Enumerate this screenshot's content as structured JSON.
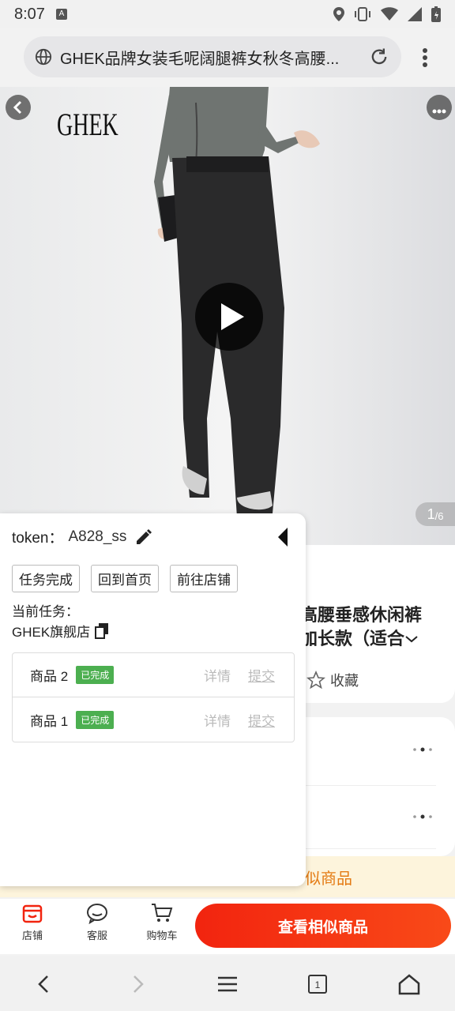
{
  "status_bar": {
    "time": "8:07",
    "a_badge": "A"
  },
  "browser": {
    "url_title": "GHEK品牌女装毛呢阔腿裤女秋冬高腰..."
  },
  "hero": {
    "brand": "GHEK",
    "pager_current": "1",
    "pager_total": "/6"
  },
  "product": {
    "title_line1": "高腰垂感休闲裤",
    "title_line2": "加长款（适合",
    "favorite_label": "收藏"
  },
  "similar_banner": "似商品",
  "panel": {
    "token_label": "token：",
    "token_value": "A828_ss",
    "buttons": [
      "任务完成",
      "回到首页",
      "前往店铺"
    ],
    "current_task_label": "当前任务：",
    "current_task_name": "GHEK旗舰店",
    "tasks": [
      {
        "name": "商品 2",
        "status": "已完成",
        "detail": "详情",
        "submit": "提交"
      },
      {
        "name": "商品 1",
        "status": "已完成",
        "detail": "详情",
        "submit": "提交"
      }
    ]
  },
  "bottom_bar": {
    "shop": "店铺",
    "service": "客服",
    "cart": "购物车",
    "cta": "查看相似商品"
  },
  "colors": {
    "accent": "#f2240f",
    "badge_green": "#4caf50",
    "banner_text": "#e47b14"
  }
}
